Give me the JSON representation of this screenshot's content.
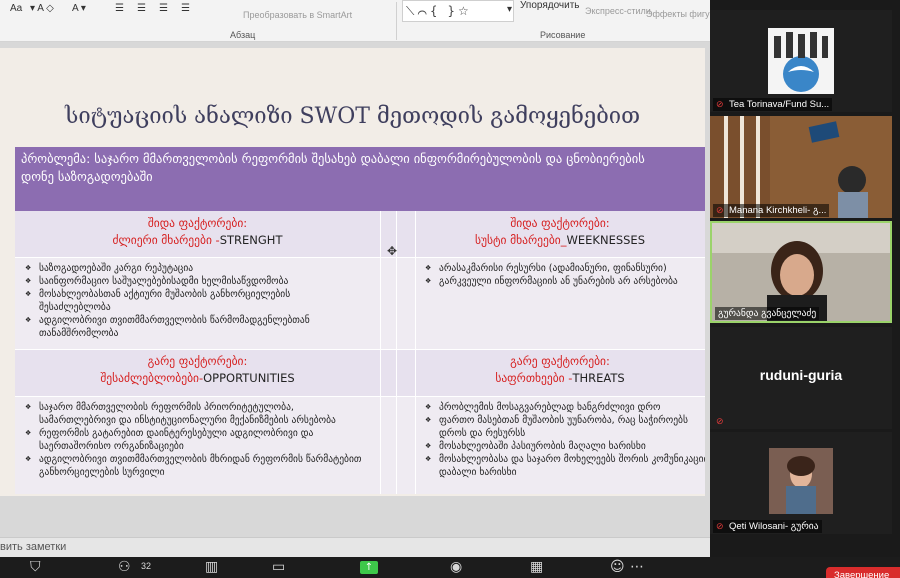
{
  "ribbon": {
    "font_size_label": "Aa",
    "convert_smartart": "Преобразовать в SmartArt",
    "paragraph_group": "Абзац",
    "shapes_glyphs": "⟍⌒{ }☆",
    "arrange_label": "Упорядочить",
    "quick_styles": "Экспресс-стили",
    "shape_effects": "Эффекты фигур",
    "drawing_group": "Рисование"
  },
  "slide": {
    "title": "სიტუაციის ანალიზი SWOT მეთოდის გამოყენებით",
    "problem_line1": "პრობლემა: საჯარო მმართველობის რეფორმის შესახებ დაბალი ინფორმირებულობის და ცნობიერების",
    "problem_line2": "დონე საზოგადოებაში",
    "strengths_label": "შიდა ფაქტორები:",
    "strengths_title_ka": "ძლიერი მხარეები -",
    "strengths_title_en": "STRENGHT",
    "weaknesses_label": "შიდა ფაქტორები:",
    "weaknesses_title_ka": "სუსტი მხარეები_",
    "weaknesses_title_en": "WEEKNESSES",
    "opportunities_label": "გარე ფაქტორები:",
    "opportunities_title_ka": "შესაძლებლობები-",
    "opportunities_title_en": "OPPORTUNITIES",
    "threats_label": "გარე ფაქტორები:",
    "threats_title_ka": "საფრთხეები -",
    "threats_title_en": "THREATS",
    "strengths_items": [
      "საზოგადოებაში კარგი რეპუტაცია",
      "საინფორმაციო საშუალებებისადმი ხელმისაწვდომობა",
      "მოსახლეობასთან აქტიური მუშაობის განხორციელების",
      "შესაძლებლობა",
      "ადგილობრივი თვითმმართველობის წარმომადგენლებთან",
      "თანამშრომლობა"
    ],
    "weaknesses_items": [
      "არასაკმარისი რესურსი (ადამიანური, ფინანსური)",
      "გარკვეული ინფორმაციის ან უნარების არ არსებობა"
    ],
    "opportunities_items": [
      "საჯარო მმართველობის რეფორმის პრიორიტეტულობა,",
      "სამართლებრივი და ინსტიტუციონალური მექანიზმების არსებობა",
      "რეფორმის გატარებით დაინტერესებული ადგილობრივი და",
      "საერთაშორისო ორგანიზაციები",
      "ადგილობრივი თვითმმართველობის მხრიდან რეფორმის წარმატებით",
      "განხორციელების სურვილი"
    ],
    "threats_items": [
      "პრობლემის მოსაგვარებლად ხანგრძლივი დრო",
      "ფართო მასებთან მუშაობის უუნარობა, რაც საჭიროებს",
      "დროს და რესურსს",
      "მოსახლეობაში პასიურობის მაღალი ხარისხი",
      "მოსახლეობასა და საჯარო მოხელეებს შორის კომუნიკაციის",
      "დაბალი ხარისხი"
    ]
  },
  "notes_text": "вить заметки",
  "participants": [
    {
      "name": "Tea Torinava/Fund Su..."
    },
    {
      "name": "Manana Kirchkheli- გ..."
    },
    {
      "name": "გურანდა გვანცელაძე"
    },
    {
      "name": "ruduni-guria"
    },
    {
      "name": "Qeti Wilosani- გურია"
    }
  ],
  "toolbar": {
    "participants_count": "32",
    "end_button": "Завершение"
  },
  "colors": {
    "header_purple": "#8c6db1",
    "cell_light": "#e7e1ee",
    "factor_red": "#d62020",
    "end_red": "#d92c2c"
  }
}
